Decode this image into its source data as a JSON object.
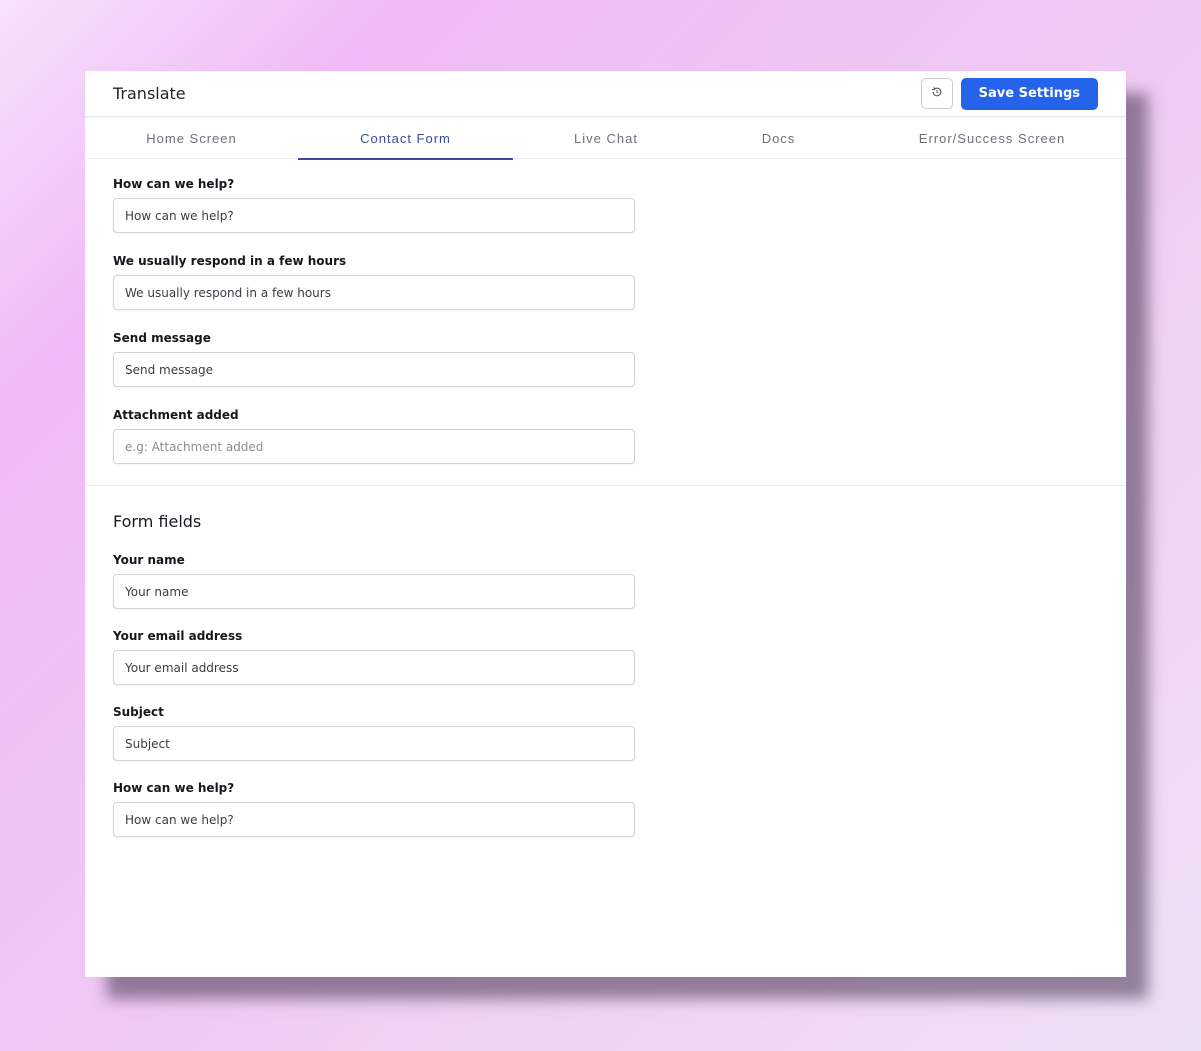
{
  "header": {
    "title": "Translate",
    "reset_icon": "reset-icon",
    "save_label": "Save Settings"
  },
  "tabs": [
    {
      "label": "Home Screen"
    },
    {
      "label": "Contact Form"
    },
    {
      "label": "Live Chat"
    },
    {
      "label": "Docs"
    },
    {
      "label": "Error/Success Screen"
    }
  ],
  "active_tab": "Contact Form",
  "contact_form": {
    "fields": [
      {
        "label": "How can we help?",
        "value": "How can we help?",
        "placeholder": ""
      },
      {
        "label": "We usually respond in a few hours",
        "value": "We usually respond in a few hours",
        "placeholder": ""
      },
      {
        "label": "Send message",
        "value": "Send message",
        "placeholder": ""
      },
      {
        "label": "Attachment added",
        "value": "",
        "placeholder": "e.g: Attachment added"
      }
    ]
  },
  "form_fields": {
    "title": "Form fields",
    "fields": [
      {
        "label": "Your name",
        "value": "Your name"
      },
      {
        "label": "Your email address",
        "value": "Your email address"
      },
      {
        "label": "Subject",
        "value": "Subject"
      },
      {
        "label": "How can we help?",
        "value": "How can we help?"
      }
    ]
  },
  "colors": {
    "accent": "#2563eb",
    "active_tab": "#3b4aa0"
  }
}
